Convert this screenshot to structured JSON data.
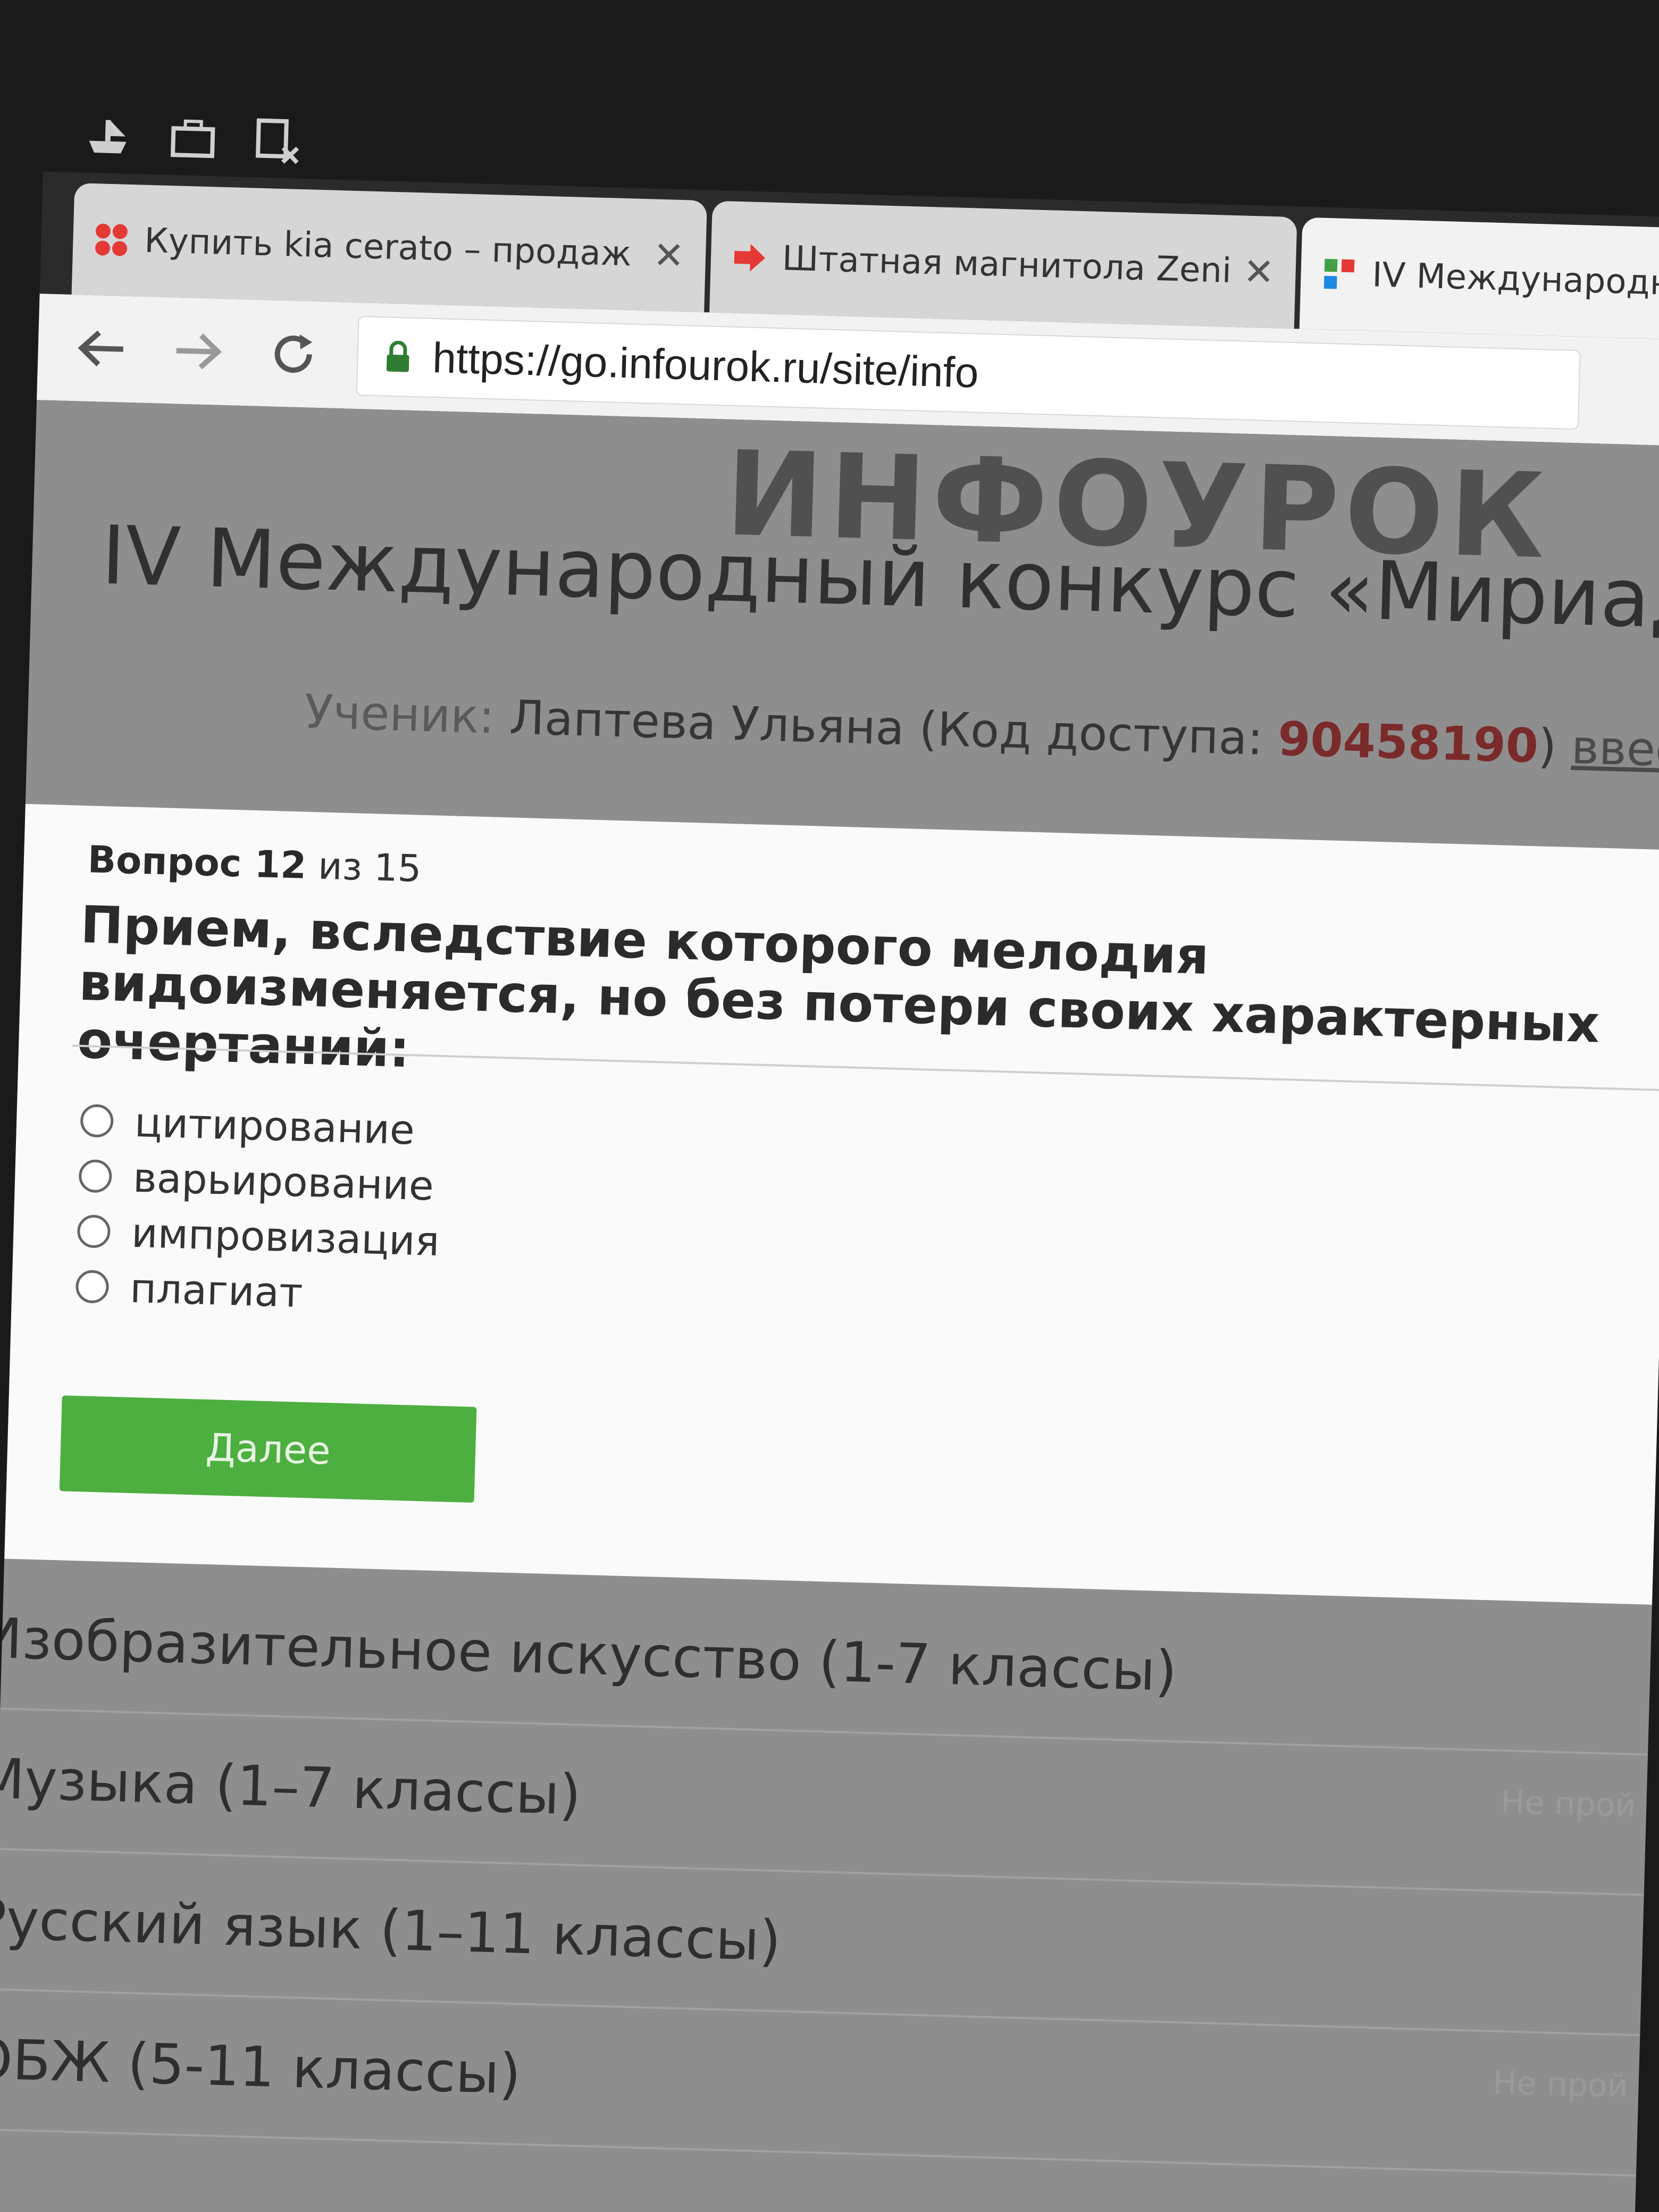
{
  "tabs": [
    {
      "title": "Купить kia cerato – продаж",
      "favicon_color": "#e53935"
    },
    {
      "title": "Штатная магнитола Zenith",
      "favicon_color": "#e53935"
    },
    {
      "title": "IV Международный ко",
      "favicon_color": "#43a047"
    }
  ],
  "toolbar": {
    "url": "https://go.infourok.ru/site/info"
  },
  "page": {
    "logo": "ИНФОУРОК",
    "title": "IV Международный конкурс «Мириады о",
    "student": {
      "label": "Ученик:",
      "name": "Лаптева Ульяна (Код доступа:",
      "code": "90458190",
      "close": ")",
      "link": "ввести дру"
    }
  },
  "question": {
    "label": "Вопрос 12",
    "of": "из 15",
    "text": "Прием, вследствие которого мелодия видоизменяется, но без потери своих характерных очертаний:",
    "options": [
      "цитирование",
      "варьирование",
      "импровизация",
      "плагиат"
    ],
    "next_label": "Далее"
  },
  "subjects": [
    {
      "name": "Изобразительное искусство (1-7 классы)",
      "status": ""
    },
    {
      "name": "Музыка (1–7 классы)",
      "status": "Не прой"
    },
    {
      "name": "Русский язык (1–11 классы)",
      "status": ""
    },
    {
      "name": "ОБЖ (5-11 классы)",
      "status": "Не прой"
    }
  ],
  "colors": {
    "accent_green": "#4caf3f",
    "code_red": "#7a2a2a"
  }
}
